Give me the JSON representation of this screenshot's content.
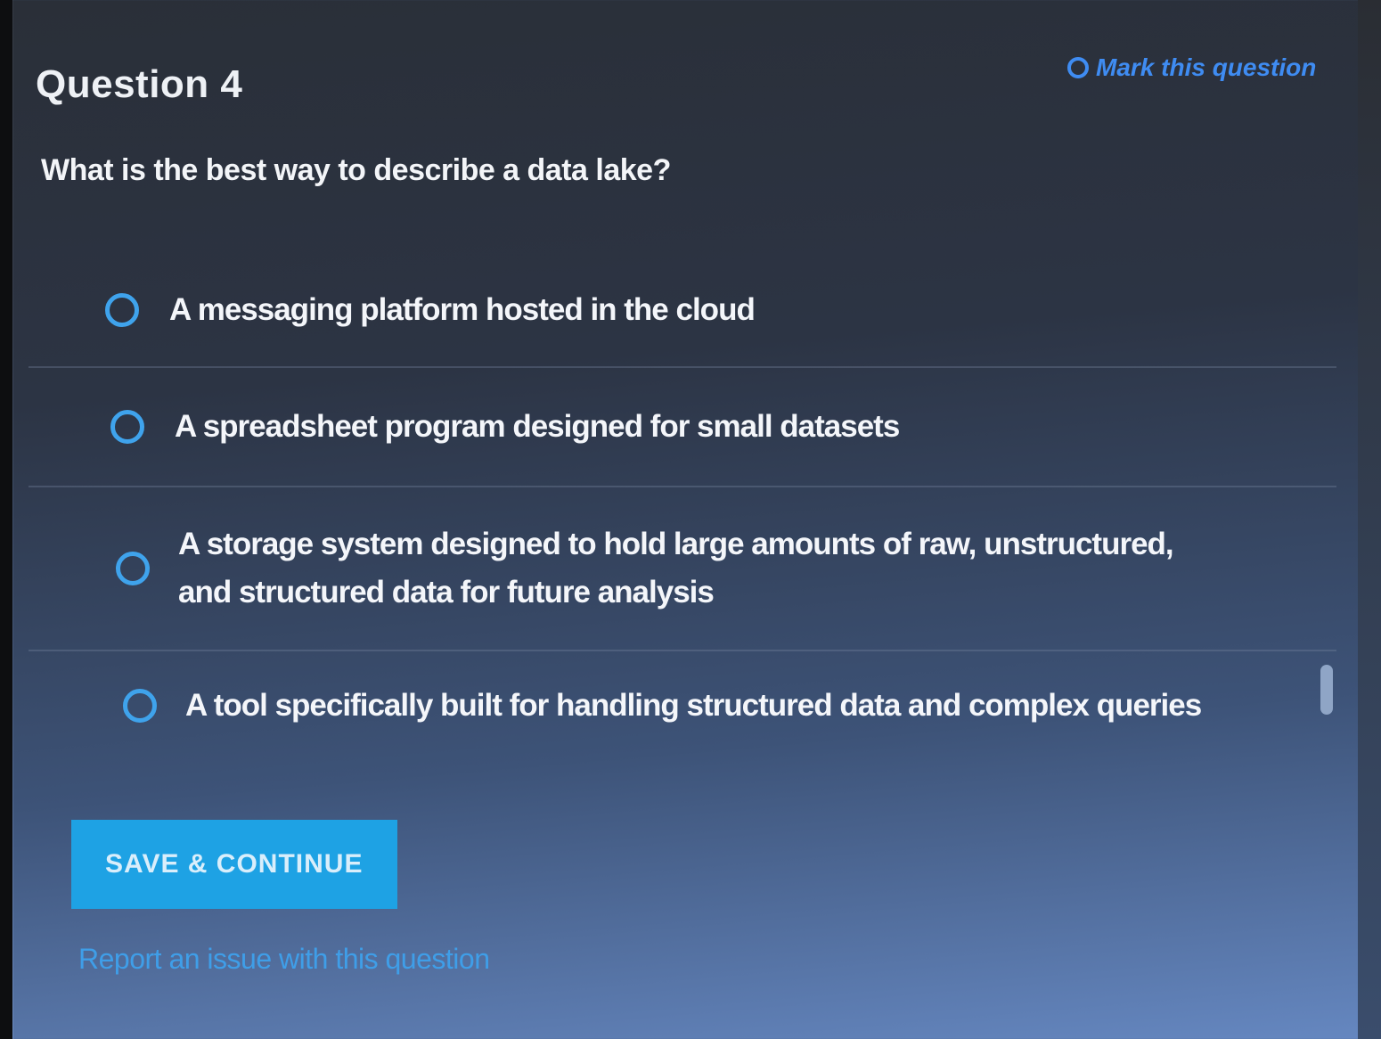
{
  "question": {
    "title": "Question 4",
    "text": "What is the best way to describe a data lake?"
  },
  "mark_question": {
    "label": "Mark this question"
  },
  "options": [
    {
      "label": "A messaging platform hosted in the cloud",
      "selected": false
    },
    {
      "label": "A spreadsheet program designed for small datasets",
      "selected": false
    },
    {
      "label": "A storage system designed to hold large amounts of raw, unstructured, and structured data for future analysis",
      "selected": false
    },
    {
      "label": "A tool specifically built for handling structured data and complex queries",
      "selected": false
    }
  ],
  "actions": {
    "save_label": "SAVE & CONTINUE",
    "report_label": "Report an issue with this question"
  },
  "colors": {
    "accent": "#1ea2e4",
    "radio": "#3fa3ec",
    "link": "#3f8cf2"
  }
}
